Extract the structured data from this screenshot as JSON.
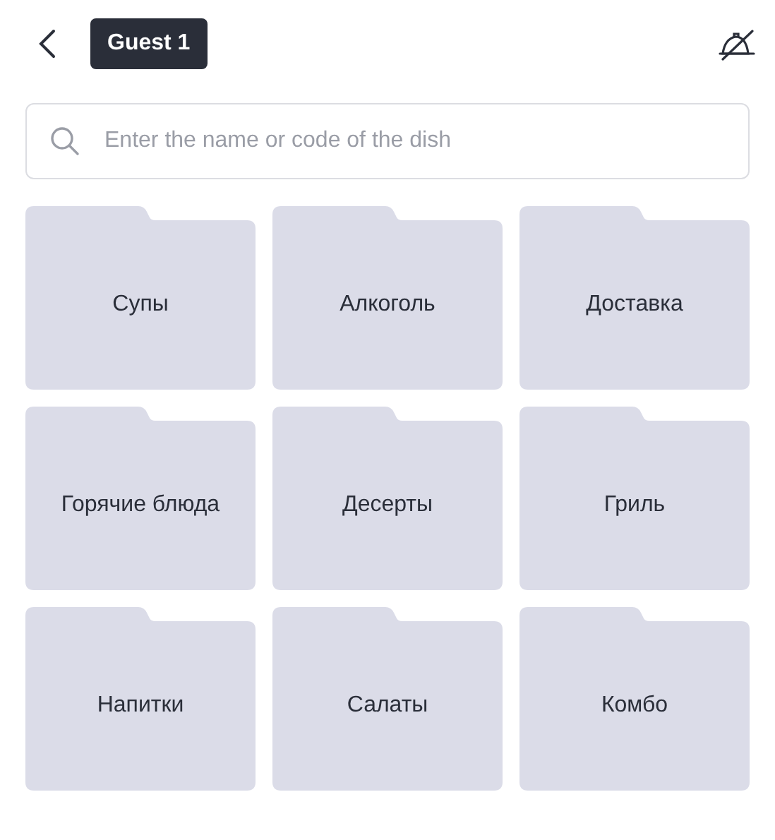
{
  "header": {
    "guest": "Guest 1"
  },
  "search": {
    "placeholder": "Enter the name or code of the dish"
  },
  "categories": [
    {
      "label": "Супы"
    },
    {
      "label": "Алкоголь"
    },
    {
      "label": "Доставка"
    },
    {
      "label": "Горячие блюда"
    },
    {
      "label": "Десерты"
    },
    {
      "label": "Гриль"
    },
    {
      "label": "Напитки"
    },
    {
      "label": "Салаты"
    },
    {
      "label": "Комбо"
    }
  ]
}
